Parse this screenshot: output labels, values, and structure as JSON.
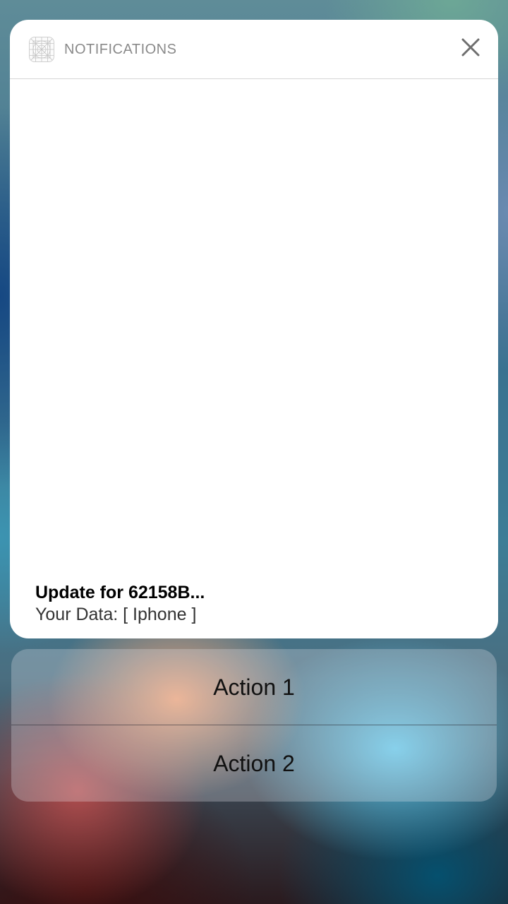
{
  "notification": {
    "header_title": "NOTIFICATIONS",
    "app_icon": "app-placeholder-icon",
    "close_icon": "close-icon",
    "title": "Update for 62158B...",
    "body": "Your Data: [ Iphone ]"
  },
  "actions": [
    {
      "label": "Action 1"
    },
    {
      "label": "Action 2"
    }
  ],
  "colors": {
    "card_background": "#ffffff",
    "header_text": "#8a8a8a",
    "close_icon": "#6e6e6e",
    "title_text": "#000000",
    "body_text": "#333333"
  }
}
